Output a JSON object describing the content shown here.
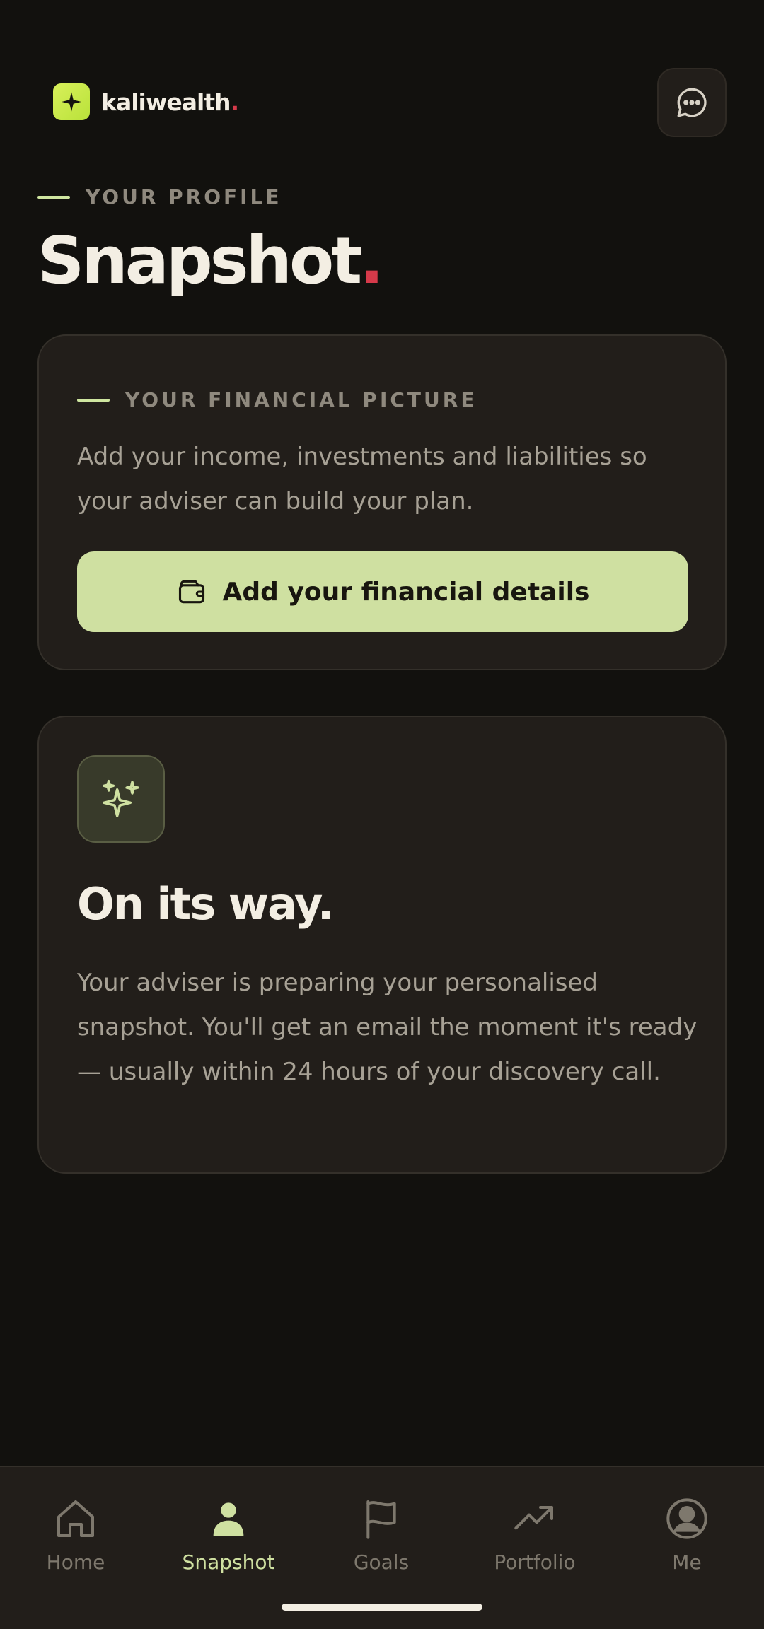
{
  "app": {
    "brand_name": "kaliwealth",
    "brand_dot": ".",
    "logo_icon": "sparkle-icon",
    "chat_icon": "chat-bubble-icon"
  },
  "header": {
    "eyebrow": "YOUR PROFILE",
    "title": "Snapshot",
    "title_dot": "."
  },
  "financial_card": {
    "eyebrow": "YOUR FINANCIAL PICTURE",
    "description": "Add your income, investments and liabilities so your adviser can build your plan.",
    "button_label": "Add your financial details",
    "button_icon": "wallet-icon"
  },
  "status_card": {
    "icon": "sparkles-icon",
    "title": "On its way.",
    "description": "Your adviser is preparing your personalised snapshot. You'll get an email the moment it's ready — usually within 24 hours of your discovery call."
  },
  "nav": {
    "items": [
      {
        "label": "Home",
        "icon": "home-icon",
        "active": false
      },
      {
        "label": "Snapshot",
        "icon": "person-icon",
        "active": true
      },
      {
        "label": "Goals",
        "icon": "flag-icon",
        "active": false
      },
      {
        "label": "Portfolio",
        "icon": "trending-up-icon",
        "active": false
      },
      {
        "label": "Me",
        "icon": "user-circle-icon",
        "active": false
      }
    ]
  },
  "colors": {
    "background": "#12110e",
    "card": "#221e1a",
    "accent": "#cfe0a1",
    "brand_lime": "#c8ea48",
    "dot_red": "#d63a4a",
    "text_primary": "#f3eee3",
    "text_muted": "#a7a195"
  }
}
